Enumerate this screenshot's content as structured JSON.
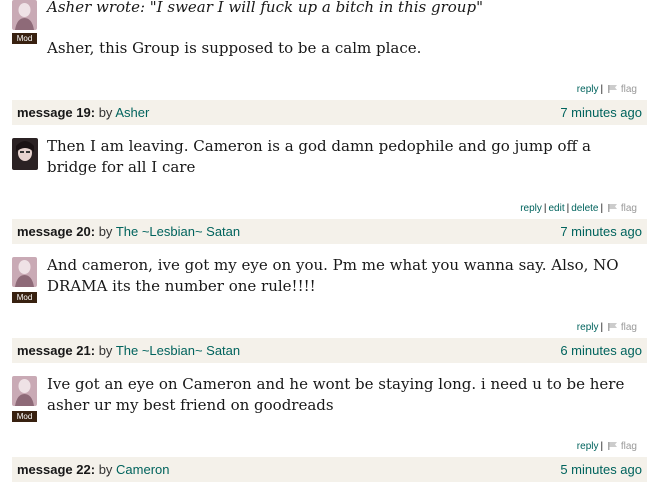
{
  "posts": [
    {
      "avatar": "mod",
      "mod_badge": "Mod",
      "quote": "Asher wrote: \"I swear I will fuck up a bitch in this group\"",
      "body": "Asher, this Group is supposed to be a calm place.",
      "actions": [
        "reply"
      ],
      "flag": "flag"
    },
    {
      "header": {
        "label": "message 19:",
        "by": "by",
        "author": "Asher",
        "time": "7 minutes ago"
      },
      "avatar": "asher",
      "body": "Then I am leaving. Cameron is a god damn pedophile and go jump off a bridge for all I care",
      "actions": [
        "reply",
        "edit",
        "delete"
      ],
      "flag": "flag"
    },
    {
      "header": {
        "label": "message 20:",
        "by": "by",
        "author": "The ~Lesbian~ Satan",
        "time": "7 minutes ago"
      },
      "avatar": "mod",
      "mod_badge": "Mod",
      "body": "And cameron, ive got my eye on you. Pm me what you wanna say. Also, NO DRAMA its the number one rule!!!!",
      "actions": [
        "reply"
      ],
      "flag": "flag"
    },
    {
      "header": {
        "label": "message 21:",
        "by": "by",
        "author": "The ~Lesbian~ Satan",
        "time": "6 minutes ago"
      },
      "avatar": "mod",
      "mod_badge": "Mod",
      "body": "Ive got an eye on Cameron and he wont be staying long. i need u to be here asher ur my best friend on goodreads",
      "actions": [
        "reply"
      ],
      "flag": "flag"
    },
    {
      "header": {
        "label": "message 22:",
        "by": "by",
        "author": "Cameron",
        "time": "5 minutes ago"
      }
    }
  ],
  "colors": {
    "link": "#00635d",
    "header_bg": "#f4f1ea",
    "mod_badge_bg": "#382110"
  },
  "icons": {
    "flag": "flag-icon"
  }
}
